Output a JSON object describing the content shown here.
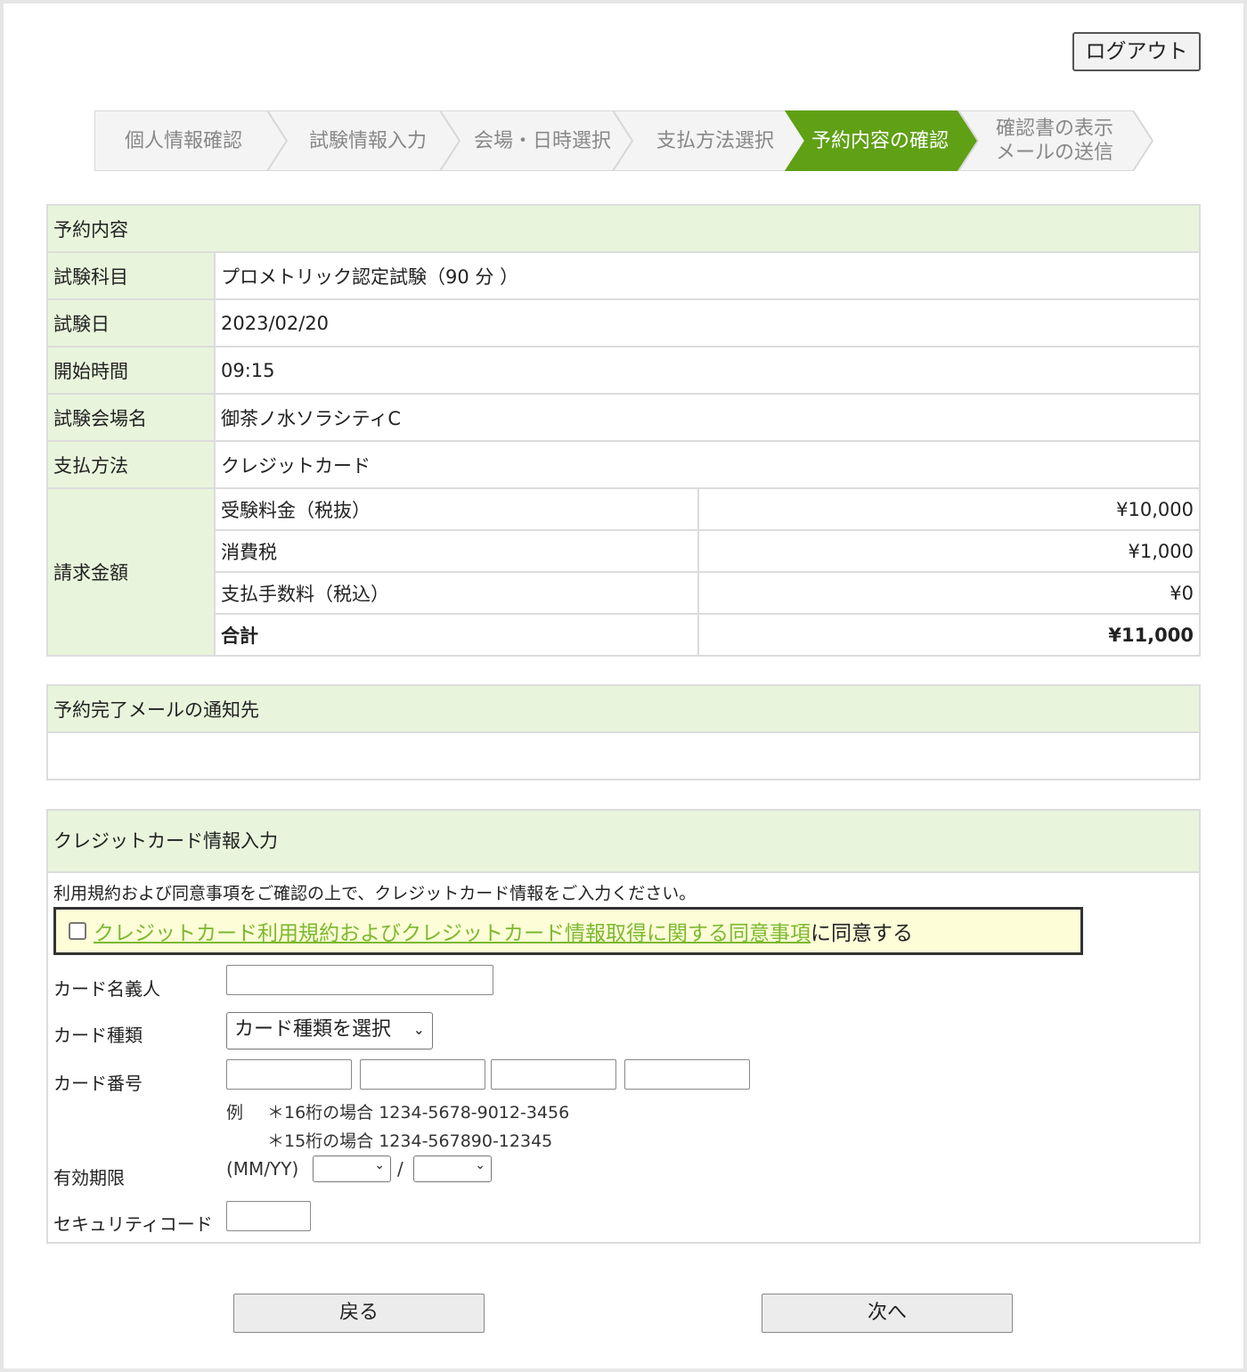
{
  "header": {
    "logout_label": "ログアウト"
  },
  "steps": [
    {
      "label": "個人情報確認",
      "active": false
    },
    {
      "label": "試験情報入力",
      "active": false
    },
    {
      "label": "会場・日時選択",
      "active": false
    },
    {
      "label": "支払方法選択",
      "active": false
    },
    {
      "label": "予約内容の確認",
      "active": true
    },
    {
      "label_line1": "確認書の表示",
      "label_line2": "メールの送信",
      "active": false
    }
  ],
  "colors": {
    "active_step": "#5fa015",
    "section_bg": "#e8f5dc",
    "link": "#7cb82f",
    "agree_bg": "#fdfdd8"
  },
  "reservation": {
    "section_title": "予約内容",
    "rows": [
      {
        "label": "試験科目",
        "value": "プロメトリック認定試験（90 分 ）"
      },
      {
        "label": "試験日",
        "value": "2023/02/20"
      },
      {
        "label": "開始時間",
        "value": "09:15"
      },
      {
        "label": "試験会場名",
        "value": "御茶ノ水ソラシティC"
      },
      {
        "label": "支払方法",
        "value": "クレジットカード"
      }
    ],
    "billing": {
      "label": "請求金額",
      "items": [
        {
          "name": "受験料金（税抜）",
          "amount": "¥10,000"
        },
        {
          "name": "消費税",
          "amount": "¥1,000"
        },
        {
          "name": "支払手数料（税込）",
          "amount": "¥0"
        },
        {
          "name": "合計",
          "amount": "¥11,000"
        }
      ]
    }
  },
  "notification": {
    "section_title": "予約完了メールの通知先",
    "value": ""
  },
  "card": {
    "section_title": "クレジットカード情報入力",
    "intro": "利用規約および同意事項をご確認の上で、クレジットカード情報をご入力ください。",
    "agree_link": "クレジットカード利用規約およびクレジットカード情報取得に関する同意事項",
    "agree_suffix": "に同意する",
    "agree_checked": false,
    "holder_label": "カード名義人",
    "holder_value": "",
    "type_label": "カード種類",
    "type_selected": "カード種類を選択",
    "number_label": "カード番号",
    "example_prefix": "例",
    "example_16": "＊16桁の場合 1234-5678-9012-3456",
    "example_15": "＊15桁の場合 1234-567890-12345",
    "expiry_label": "有効期限",
    "expiry_format": "(MM/YY)",
    "expiry_sep": "/",
    "cvc_label": "セキュリティコード"
  },
  "footer": {
    "back_label": "戻る",
    "next_label": "次へ"
  }
}
